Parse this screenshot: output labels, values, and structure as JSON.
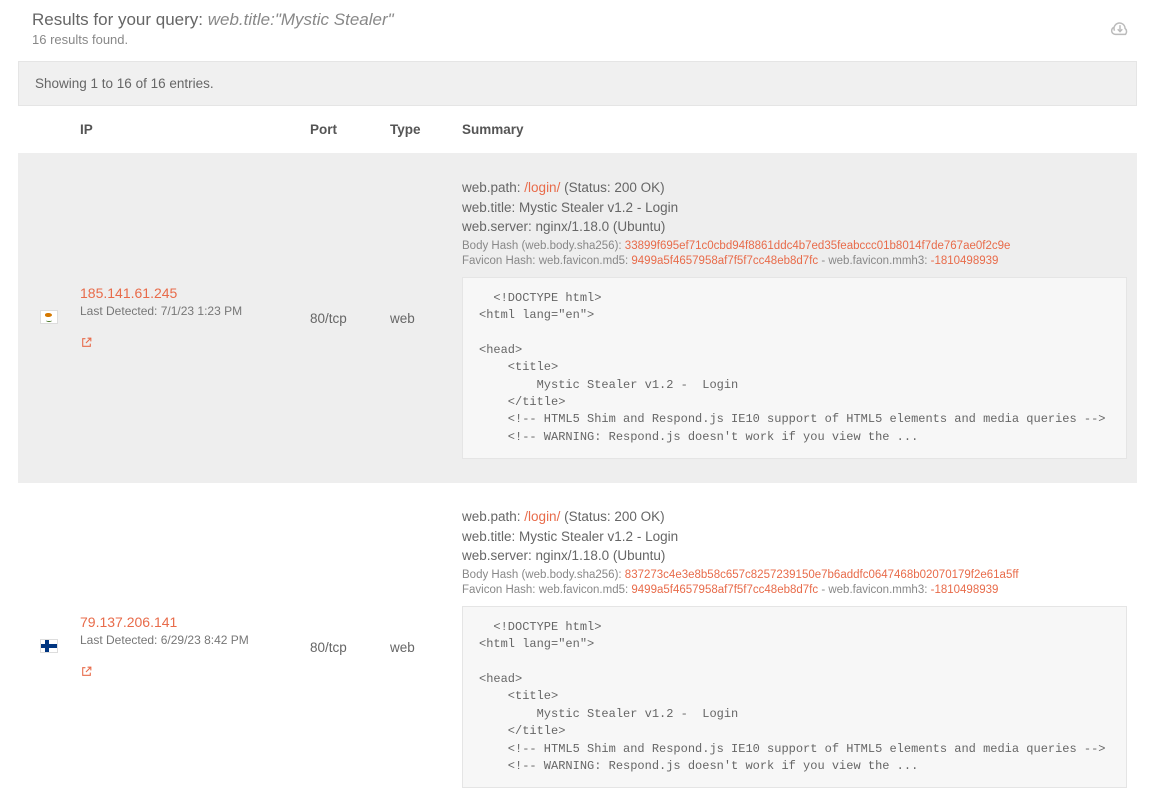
{
  "header": {
    "title_prefix": "Results for your query: ",
    "query_text": "web.title:\"Mystic Stealer\"",
    "results_count": "16 results found."
  },
  "showing": "Showing 1 to 16 of 16 entries.",
  "columns": {
    "ip": "IP",
    "port": "Port",
    "type": "Type",
    "summary": "Summary"
  },
  "rows": [
    {
      "flag": "cy",
      "ip": "185.141.61.245",
      "last_detected": "Last Detected: 7/1/23 1:23 PM",
      "port": "80/tcp",
      "type": "web",
      "summary": {
        "path_label": "web.path: ",
        "path_value": "/login/",
        "status": " (Status: 200 OK)",
        "title_label": "web.title: ",
        "title_value": "Mystic Stealer v1.2 - Login",
        "server_label": "web.server: ",
        "server_value": "nginx/1.18.0 (Ubuntu)",
        "body_hash_label": "Body Hash (web.body.sha256): ",
        "body_hash_value": "33899f695ef71c0cbd94f8861ddc4b7ed35feabccc01b8014f7de767ae0f2c9e",
        "favicon_label": "Favicon Hash: web.favicon.md5: ",
        "favicon_value": "9499a5f4657958af7f5f7cc48eb8d7fc",
        "mmh3_label": " - web.favicon.mmh3: ",
        "mmh3_value": "-1810498939",
        "code": "  <!DOCTYPE html>\n<html lang=\"en\">\n\n<head>\n    <title>\n        Mystic Stealer v1.2 -  Login\n    </title>\n    <!-- HTML5 Shim and Respond.js IE10 support of HTML5 elements and media queries -->\n    <!-- WARNING: Respond.js doesn't work if you view the ..."
      }
    },
    {
      "flag": "fi",
      "ip": "79.137.206.141",
      "last_detected": "Last Detected: 6/29/23 8:42 PM",
      "port": "80/tcp",
      "type": "web",
      "summary": {
        "path_label": "web.path: ",
        "path_value": "/login/",
        "status": " (Status: 200 OK)",
        "title_label": "web.title: ",
        "title_value": "Mystic Stealer v1.2 - Login",
        "server_label": "web.server: ",
        "server_value": "nginx/1.18.0 (Ubuntu)",
        "body_hash_label": "Body Hash (web.body.sha256): ",
        "body_hash_value": "837273c4e3e8b58c657c8257239150e7b6addfc0647468b02070179f2e61a5ff",
        "favicon_label": "Favicon Hash: web.favicon.md5: ",
        "favicon_value": "9499a5f4657958af7f5f7cc48eb8d7fc",
        "mmh3_label": " - web.favicon.mmh3: ",
        "mmh3_value": "-1810498939",
        "code": "  <!DOCTYPE html>\n<html lang=\"en\">\n\n<head>\n    <title>\n        Mystic Stealer v1.2 -  Login\n    </title>\n    <!-- HTML5 Shim and Respond.js IE10 support of HTML5 elements and media queries -->\n    <!-- WARNING: Respond.js doesn't work if you view the ..."
      }
    }
  ]
}
